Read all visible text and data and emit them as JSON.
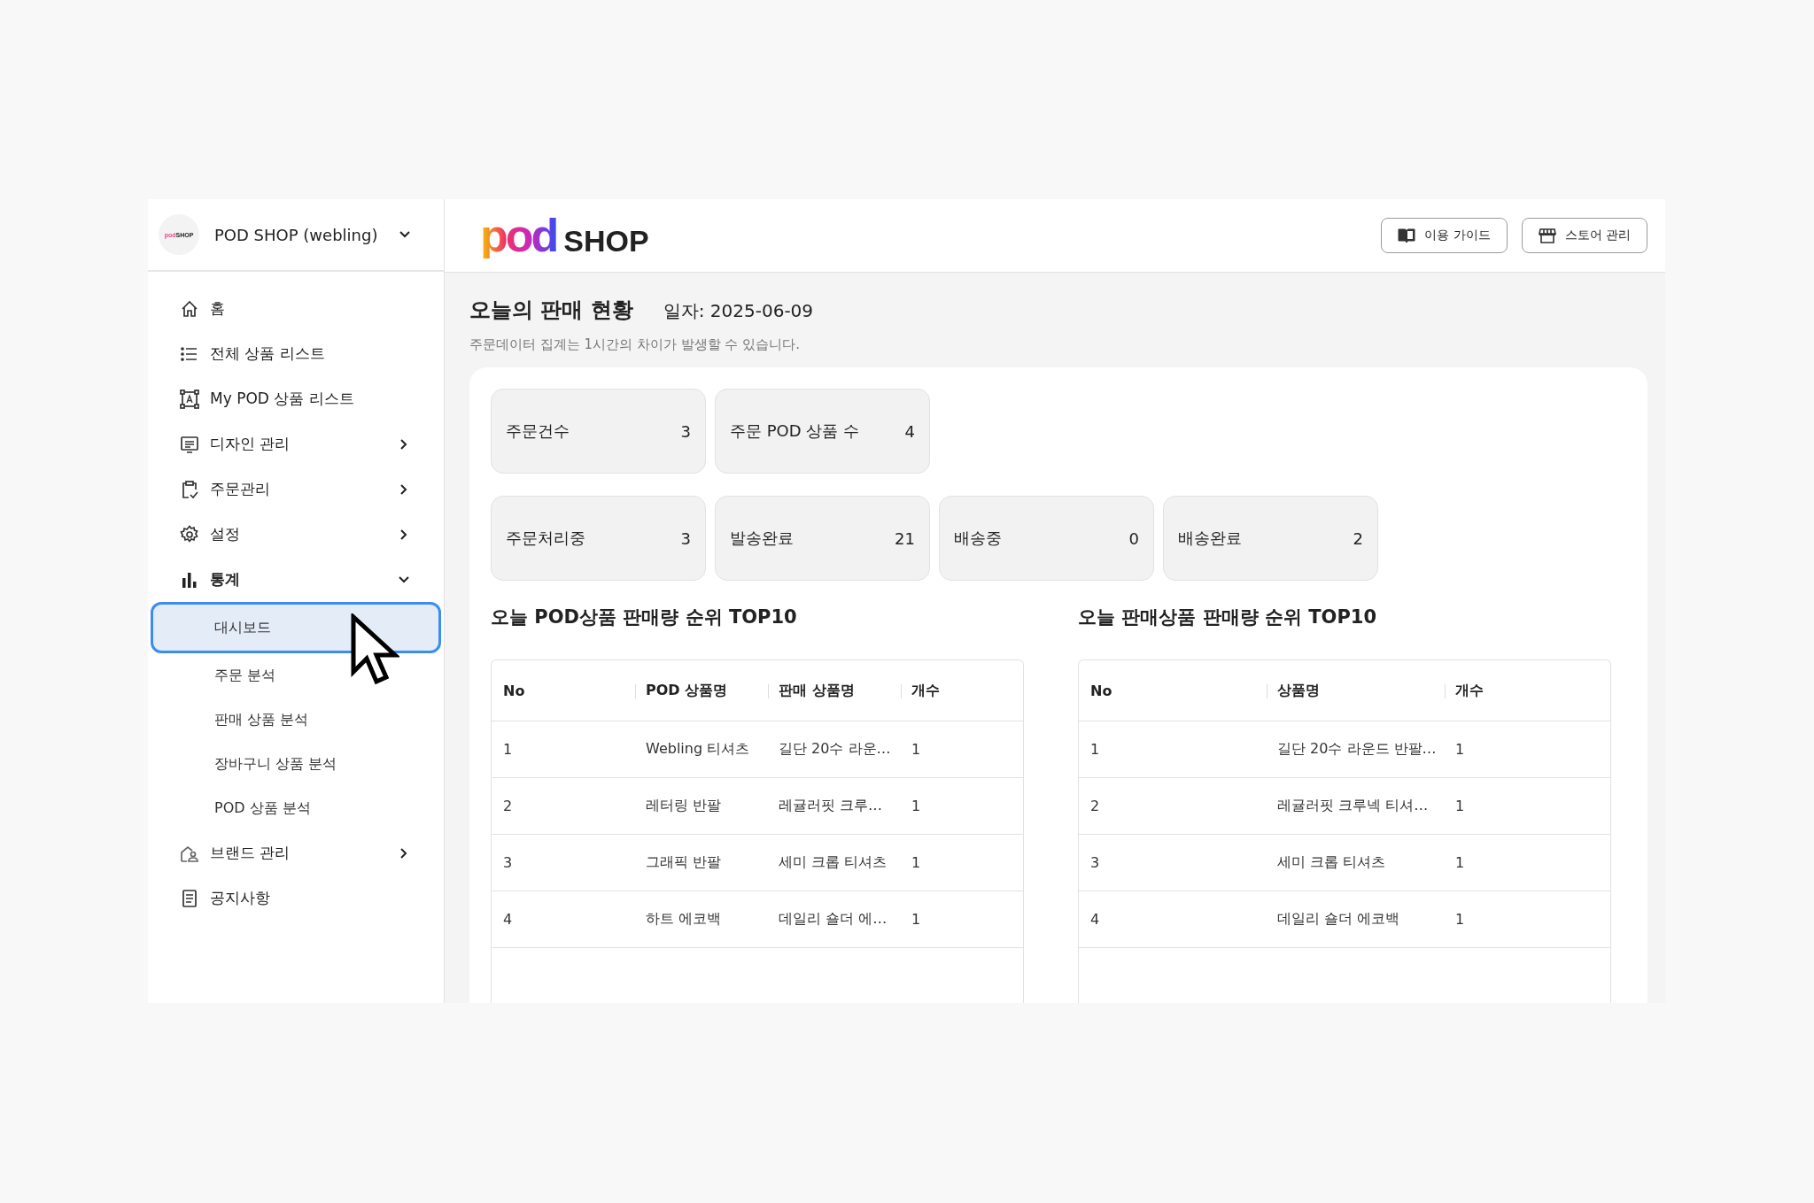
{
  "sidebar": {
    "account": {
      "logo_mark": "pod",
      "logo_text": "SHOP",
      "name": "POD SHOP (webling)"
    },
    "items": [
      {
        "kind": "link",
        "label": "홈"
      },
      {
        "kind": "link",
        "label": "전체 상품 리스트"
      },
      {
        "kind": "link",
        "label": "My POD 상품 리스트"
      },
      {
        "kind": "group",
        "label": "디자인 관리",
        "expanded": false
      },
      {
        "kind": "group",
        "label": "주문관리",
        "expanded": false
      },
      {
        "kind": "group",
        "label": "설정",
        "expanded": false
      },
      {
        "kind": "group",
        "label": "통계",
        "expanded": true,
        "children": [
          {
            "label": "대시보드",
            "selected": true
          },
          {
            "label": "주문 분석",
            "selected": false
          },
          {
            "label": "판매 상품 분석",
            "selected": false
          },
          {
            "label": "장바구니 상품 분석",
            "selected": false
          },
          {
            "label": "POD 상품 분석",
            "selected": false
          }
        ]
      },
      {
        "kind": "group",
        "label": "브랜드 관리",
        "expanded": false
      },
      {
        "kind": "link",
        "label": "공지사항"
      }
    ]
  },
  "header": {
    "logo": {
      "mark": "pod",
      "text": "SHOP"
    },
    "buttons": [
      "이용 가이드",
      "스토어 관리"
    ]
  },
  "page": {
    "title": "오늘의 판매 현황",
    "date": "일자: 2025-06-09",
    "note": "주문데이터 집계는 1시간의 차이가 발생할 수 있습니다."
  },
  "stats": [
    [
      {
        "label": "주문건수",
        "value": "3"
      },
      {
        "label": "주문 POD 상품 수",
        "value": "4"
      }
    ],
    [
      {
        "label": "주문처리중",
        "value": "3"
      },
      {
        "label": "발송완료",
        "value": "21"
      },
      {
        "label": "배송중",
        "value": "0"
      },
      {
        "label": "배송완료",
        "value": "2"
      }
    ]
  ],
  "tables": [
    {
      "title": "오늘 POD상품 판매량 순위 TOP10",
      "columns": [
        "No",
        "POD 상품명",
        "판매 상품명",
        "개수"
      ],
      "rows": [
        [
          "1",
          "Webling 티셔츠",
          "길단 20수 라운…",
          "1"
        ],
        [
          "2",
          "레터링 반팔",
          "레귤러핏 크루…",
          "1"
        ],
        [
          "3",
          "그래픽 반팔",
          "세미 크롭 티셔츠",
          "1"
        ],
        [
          "4",
          "하트 에코백",
          "데일리 숄더 에…",
          "1"
        ]
      ]
    },
    {
      "title": "오늘 판매상품 판매량 순위 TOP10",
      "columns": [
        "No",
        "상품명",
        "개수"
      ],
      "rows": [
        [
          "1",
          "길단 20수 라운드 반팔…",
          "1"
        ],
        [
          "2",
          "레귤러핏 크루넥 티셔…",
          "1"
        ],
        [
          "3",
          "세미 크롭 티셔츠",
          "1"
        ],
        [
          "4",
          "데일리 숄더 에코백",
          "1"
        ]
      ]
    }
  ]
}
